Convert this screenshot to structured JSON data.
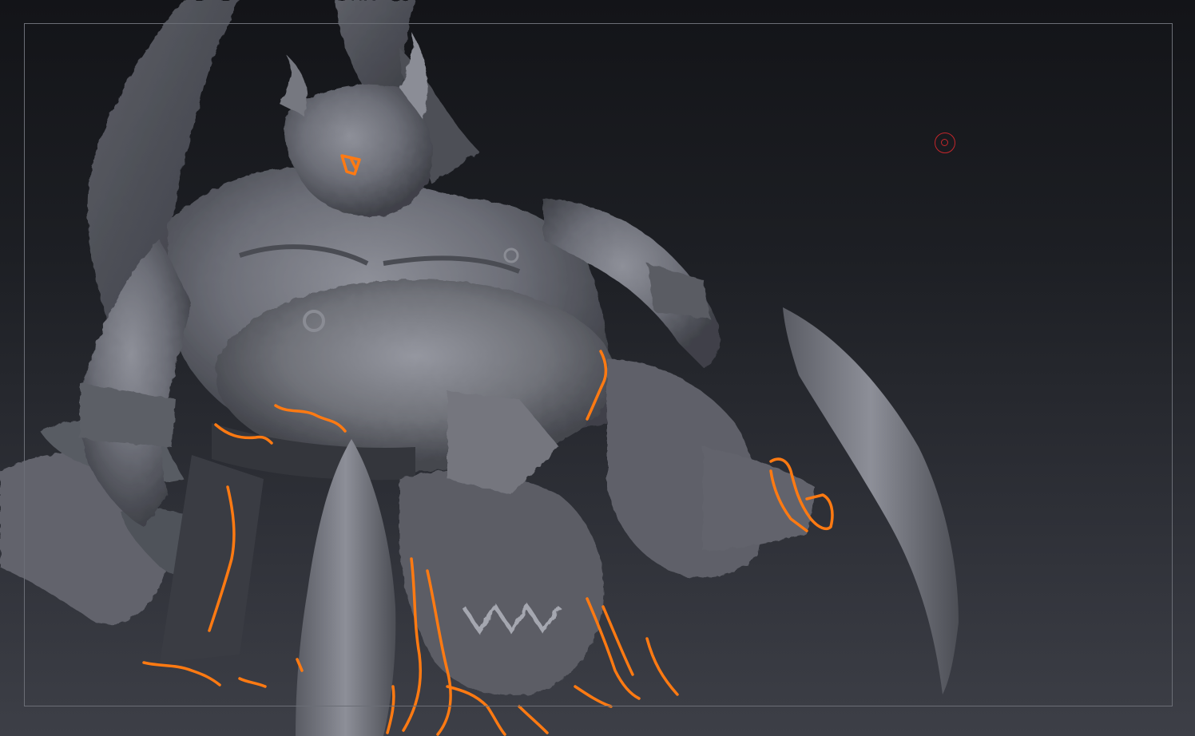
{
  "canvas": {
    "background_top": "#131418",
    "background_bottom": "#3d3f47",
    "frame_color": "#6b6e76"
  },
  "model": {
    "surface_color": "#6e7079",
    "shadow_color": "#3a3c43",
    "highlight_color": "#9a9ca5"
  },
  "sketch_overlay": {
    "stroke_color": "#ff7a12"
  },
  "light_handle": {
    "icon": "target-circle-icon",
    "color": "#c2262b"
  }
}
